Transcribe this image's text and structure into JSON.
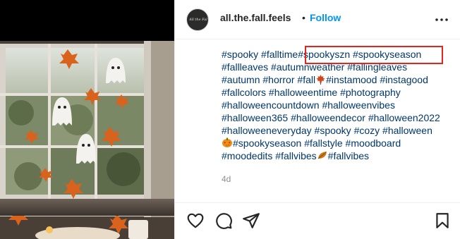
{
  "post": {
    "username": "all.the.fall.feels",
    "avatar_text": "All the Fall Feels",
    "separator": "•",
    "follow_label": "Follow",
    "timestamp": "4d"
  },
  "caption": {
    "line1_a": "#spooky",
    "line1_b": "#falltime",
    "line1_c": "#spookyszn",
    "line1_d": "#spookyseason",
    "line2_a": "#fallleaves",
    "line2_b": "#autumnweather",
    "line2_c": "#fallingleaves",
    "line3_a": "#autumn",
    "line3_b": "#horror",
    "line3_c": "#fall",
    "line3_d": "#instamood",
    "line3_e": "#instagood",
    "line4_a": "#fallcolors",
    "line4_b": "#halloweentime",
    "line4_c": "#photography",
    "line5_a": "#halloweencountdown",
    "line5_b": "#halloweenvibes",
    "line6_a": "#halloween365",
    "line6_b": "#halloweendecor",
    "line6_c": "#halloween2022",
    "line7_a": "#halloweeneveryday",
    "line7_b": "#spooky",
    "line7_c": "#cozy",
    "line7_d": "#halloween",
    "line8_a": "#spookyseason",
    "line8_b": "#fallstyle",
    "line8_c": "#moodboard",
    "line9_a": "#moodedits",
    "line9_b": "#fallvibes",
    "line9_c": "#fallvibes"
  },
  "icons": {
    "more": "more-options-icon",
    "like": "heart-icon",
    "comment": "comment-icon",
    "share": "share-icon",
    "save": "bookmark-icon",
    "maple_leaf": "maple-leaf-emoji",
    "pumpkin": "jack-o-lantern-emoji",
    "fallen_leaf": "fallen-leaf-emoji"
  },
  "colors": {
    "link": "#00376b",
    "follow": "#0095f6",
    "highlight_box": "#e8231c",
    "muted": "#8e8e8e"
  }
}
